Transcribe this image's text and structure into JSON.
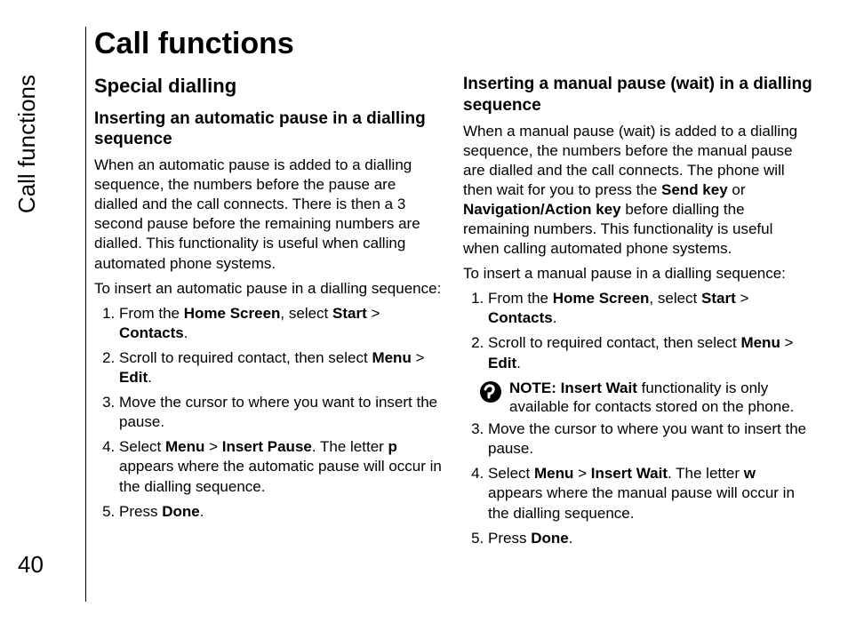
{
  "side_tab": "Call functions",
  "page_number": "40",
  "title": "Call functions",
  "left": {
    "section": "Special dialling",
    "sub1": {
      "heading": "Inserting an automatic pause in a dialling sequence",
      "para1": "When an automatic pause is added to a dialling sequence, the numbers before the pause are dialled and the call connects. There is then a 3 second pause before the remaining numbers are dialled. This functionality is useful when calling automated phone systems.",
      "para2": "To insert an automatic pause in a dialling sequence:",
      "steps": {
        "s1a": "From the ",
        "s1b": "Home Screen",
        "s1c": ", select ",
        "s1d": "Start",
        "s1e": " > ",
        "s1f": "Contacts",
        "s1g": ".",
        "s2a": "Scroll to required contact, then select ",
        "s2b": "Menu",
        "s2c": " > ",
        "s2d": "Edit",
        "s2e": ".",
        "s3": "Move the cursor to where you want to insert the pause.",
        "s4a": "Select ",
        "s4b": "Menu",
        "s4c": " > ",
        "s4d": "Insert Pause",
        "s4e": ". The letter ",
        "s4f": "p",
        "s4g": " appears where the automatic pause will occur in the dialling sequence.",
        "s5a": "Press ",
        "s5b": "Done",
        "s5c": "."
      }
    }
  },
  "right": {
    "sub1": {
      "heading": "Inserting a manual pause (wait) in a dialling sequence",
      "para1a": "When a manual pause (wait) is added to a dialling sequence, the numbers before the manual pause are dialled and the call connects. The phone will then wait for you to press the ",
      "para1b": "Send key",
      "para1c": " or ",
      "para1d": "Navigation/Action key",
      "para1e": " before dialling the remaining numbers. This functionality is useful when calling automated phone systems.",
      "para2": "To insert a manual pause in a dialling sequence:",
      "steps12": {
        "s1a": "From the ",
        "s1b": "Home Screen",
        "s1c": ", select ",
        "s1d": "Start",
        "s1e": " > ",
        "s1f": "Contacts",
        "s1g": ".",
        "s2a": "Scroll to required contact, then select ",
        "s2b": "Menu",
        "s2c": " > ",
        "s2d": "Edit",
        "s2e": "."
      },
      "note": {
        "label": "NOTE: Insert Wait",
        "rest": " functionality is only available for contacts stored on the phone."
      },
      "steps35": {
        "s3": "Move the cursor to where you want to insert the pause.",
        "s4a": "Select ",
        "s4b": "Menu",
        "s4c": " > ",
        "s4d": "Insert Wait",
        "s4e": ". The letter ",
        "s4f": "w",
        "s4g": " appears where the manual pause will occur in the dialling sequence.",
        "s5a": "Press ",
        "s5b": "Done",
        "s5c": "."
      }
    }
  }
}
